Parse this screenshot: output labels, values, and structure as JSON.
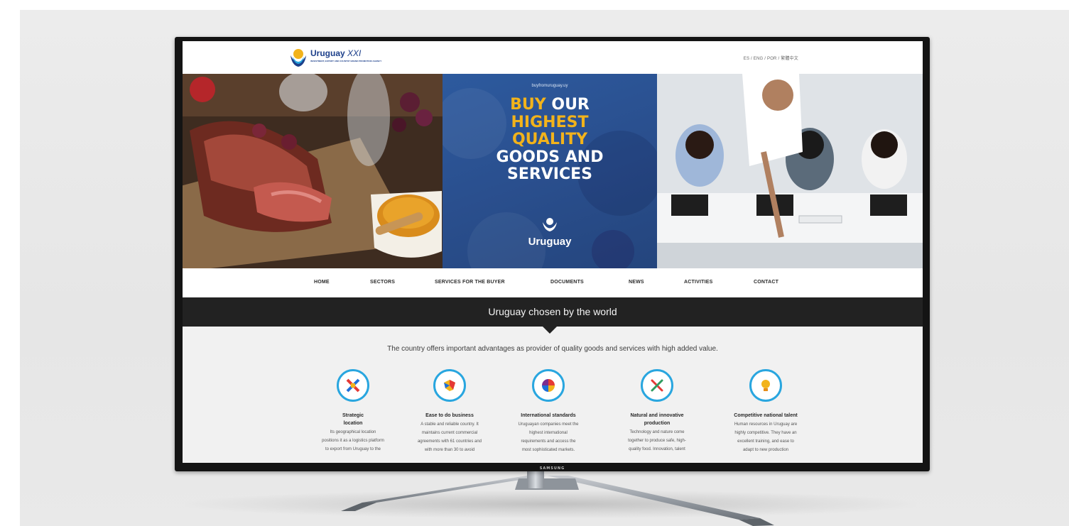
{
  "site": {
    "logo_name": "Uruguay",
    "logo_suffix": "XXI",
    "logo_tagline": "INVESTMENT, EXPORT AND COUNTRY BRAND PROMOTION AGENCY",
    "languages": "ES / ENG / POR / 繁體中文"
  },
  "hero": {
    "url": "buyfromuruguay.uy",
    "headline_yellow_1": "BUY",
    "headline_white_1": " OUR",
    "headline_yellow_2": "HIGHEST",
    "headline_yellow_3": "QUALITY",
    "headline_white_2": "GOODS AND",
    "headline_white_3": "SERVICES",
    "brand_label": "Uruguay"
  },
  "nav": {
    "items": [
      "HOME",
      "SECTORS",
      "SERVICES FOR THE BUYER",
      "DOCUMENTS",
      "NEWS",
      "ACTIVITIES",
      "CONTACT"
    ]
  },
  "band": {
    "title": "Uruguay chosen by the world"
  },
  "intro": "The country offers important advantages as provider of quality goods and services with high added value.",
  "features": [
    {
      "icon": "arrows-cross-icon",
      "title_1": "Strategic",
      "title_2": "location",
      "lines": [
        "Its geographical location",
        "positions it as a logistics platform",
        "to export from Uruguay to the"
      ]
    },
    {
      "icon": "country-map-icon",
      "title_1": "Ease to do business",
      "title_2": "",
      "lines": [
        "A stable and reliable country. It",
        "maintains current commercial",
        "agreements with 61 countries and",
        "with more than 30 to avoid"
      ]
    },
    {
      "icon": "globe-quadrant-icon",
      "title_1": "International standards",
      "title_2": "",
      "lines": [
        "Uruguayan companies meet the",
        "highest international",
        "requirements and access the",
        "most sophisticated markets."
      ]
    },
    {
      "icon": "crossed-tools-icon",
      "title_1": "Natural and innovative",
      "title_2": "production",
      "lines": [
        "Technology and nature come",
        "together to produce safe, high-",
        "quality food. Innovation, talent"
      ]
    },
    {
      "icon": "lightbulb-icon",
      "title_1": "Competitive national talent",
      "title_2": "",
      "lines": [
        "Human resources in Uruguay are",
        "highly competitive. They have an",
        "excellent training, and ease to",
        "adapt to new production"
      ]
    }
  ],
  "tv": {
    "brand": "SAMSUNG"
  },
  "colors": {
    "accent_blue": "#29a6df",
    "brand_blue": "#1c3f8a",
    "headline_yellow": "#f2b31b",
    "band_dark": "#222222"
  }
}
